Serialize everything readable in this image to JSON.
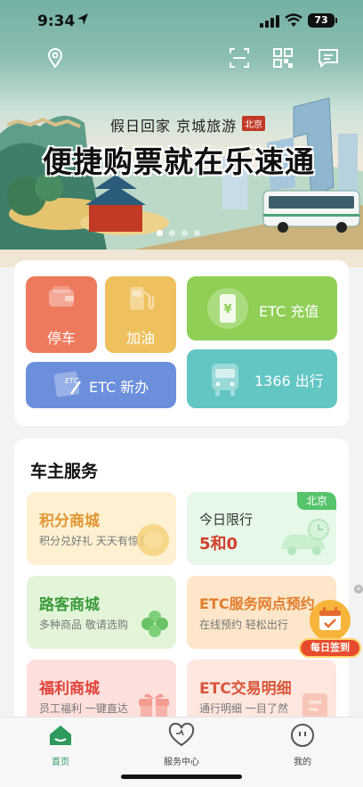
{
  "status_bar": {
    "time": "9:34",
    "battery": "73"
  },
  "topbar": {
    "icons": [
      "location-icon",
      "scan-icon",
      "qr-code-icon",
      "message-icon"
    ]
  },
  "banner": {
    "subtitle": "假日回家 京城旅游",
    "badge": "北京",
    "title": "便捷购票就在乐速通",
    "slide_count": 4,
    "active_slide": 1
  },
  "quick_actions": {
    "parking": "停车",
    "fuel": "加油",
    "etc_recharge": "ETC 充值",
    "etc_apply": "ETC 新办",
    "travel_1366": "1366 出行",
    "etc_card_text": "ETC"
  },
  "services": {
    "title": "车主服务",
    "items": [
      {
        "title": "积分商城",
        "subtitle": "积分兑好礼 天天有惊喜"
      },
      {
        "title": "今日限行",
        "value": "5和0",
        "tag": "北京"
      },
      {
        "title": "路客商城",
        "subtitle": "多种商品 敬请选购"
      },
      {
        "title": "ETC服务网点预约",
        "subtitle": "在线预约 轻松出行"
      },
      {
        "title": "福利商城",
        "subtitle": "员工福利 一键直达"
      },
      {
        "title": "ETC交易明细",
        "subtitle": "通行明细 一目了然"
      }
    ]
  },
  "checkin": {
    "label": "每日签到"
  },
  "tabs": [
    {
      "label": "首页",
      "active": true
    },
    {
      "label": "服务中心",
      "active": false
    },
    {
      "label": "我的",
      "active": false
    }
  ],
  "colors": {
    "primary_green": "#2e9a5e",
    "parking_tile": "#ee7a5e",
    "fuel_tile": "#eec15e",
    "etc_recharge_tile": "#8fcf55",
    "etc_apply_tile": "#6c8fdc",
    "travel_tile": "#63c6c3"
  }
}
